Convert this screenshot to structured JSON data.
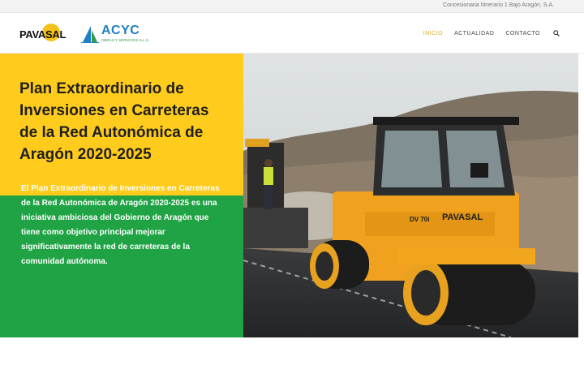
{
  "topbar": {
    "text": "Concesionaria Itinerario 1 Bajo Aragón, S.A."
  },
  "logos": {
    "pavasal": "PAVASAL",
    "acyc_name": "ACYC",
    "acyc_sub": "OBRAS Y SERVICIOS S.L.U."
  },
  "nav": {
    "items": [
      {
        "label": "INICIO",
        "active": true
      },
      {
        "label": "ACTUALIDAD",
        "active": false
      },
      {
        "label": "CONTACTO",
        "active": false
      }
    ],
    "search_icon": "search-icon"
  },
  "hero": {
    "title": "Plan Extraordinario de Inversiones en Carreteras de la Red Autonómica de Aragón 2020-2025",
    "description": "El Plan Extraordinario de Inversiones en Carreteras de la Red Autonómica de Aragón 2020-2025 es una iniciativa ambiciosa del Gobierno de Aragón que tiene como objetivo principal mejorar significativamente la red de carreteras de la comunidad autónoma.",
    "roller_label": "PAVASAL",
    "roller_model": "DV 70i"
  },
  "colors": {
    "yellow": "#ffcb1c",
    "green": "#1fa344",
    "accent": "#e8a92d",
    "acyc_blue": "#1e7fc1"
  }
}
